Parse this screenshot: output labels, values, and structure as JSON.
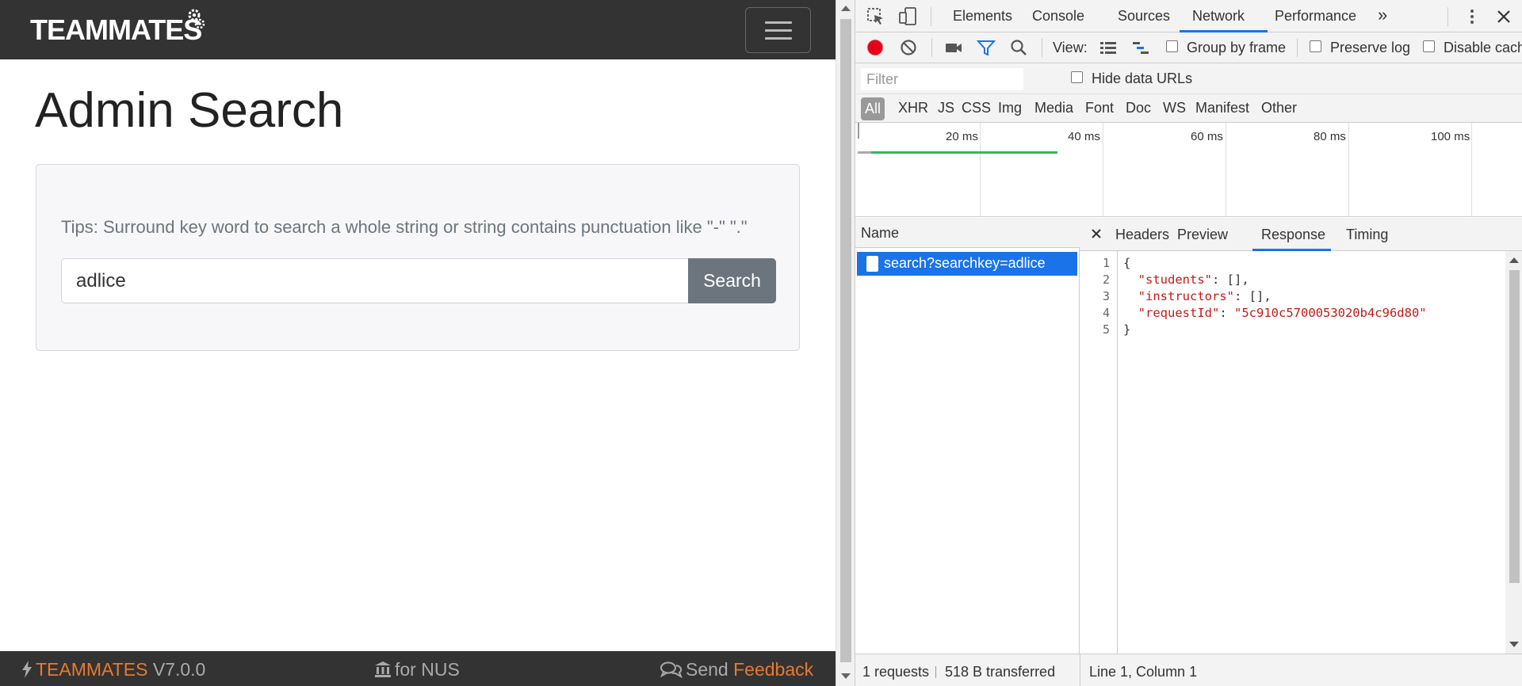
{
  "app": {
    "logo_text": "TEAMMATES",
    "page_title": "Admin Search",
    "tips": "Tips: Surround key word to search a whole string or string contains punctuation like \"-\" \".\"",
    "search_value": "adlice",
    "search_button": "Search",
    "footer": {
      "brand": "TEAMMATES",
      "version": "V7.0.0",
      "institute": "for NUS",
      "send": "Send",
      "feedback": "Feedback"
    },
    "colors": {
      "navbar": "#333333",
      "accent": "#e8792f",
      "button": "#6c757d"
    }
  },
  "devtools": {
    "tabs": [
      "Elements",
      "Console",
      "Sources",
      "Network",
      "Performance"
    ],
    "active_tab": "Network",
    "more_tabs": "»",
    "toolbar": {
      "view_label": "View:",
      "group_by_frame": "Group by frame",
      "preserve_log": "Preserve log",
      "disable_cache": "Disable cach"
    },
    "filter": {
      "placeholder": "Filter",
      "hide_data_urls": "Hide data URLs"
    },
    "types": [
      "All",
      "XHR",
      "JS",
      "CSS",
      "Img",
      "Media",
      "Font",
      "Doc",
      "WS",
      "Manifest",
      "Other"
    ],
    "timeline_labels": [
      "20 ms",
      "40 ms",
      "60 ms",
      "80 ms",
      "100 ms"
    ],
    "requests": {
      "header": "Name",
      "items": [
        "search?searchkey=adlice"
      ]
    },
    "detail_tabs": [
      "Headers",
      "Preview",
      "Response",
      "Timing"
    ],
    "active_detail_tab": "Response",
    "response": {
      "line_numbers": [
        "1",
        "2",
        "3",
        "4",
        "5"
      ],
      "open_brace": "{",
      "key_students": "\"students\"",
      "val_students": ": [],",
      "key_instructors": "\"instructors\"",
      "val_instructors": ": [],",
      "key_request_id": "\"requestId\"",
      "colon": ": ",
      "val_request_id": "\"5c910c5700053020b4c96d80\"",
      "close_brace": "}"
    },
    "status": {
      "requests": "1 requests",
      "transferred": "518 B transferred",
      "cursor": "Line 1, Column 1"
    },
    "colors": {
      "selected": "#1a73e8",
      "string": "#c41a16",
      "record": "#e8001a",
      "timeline_bar": "#2ebd59"
    }
  }
}
